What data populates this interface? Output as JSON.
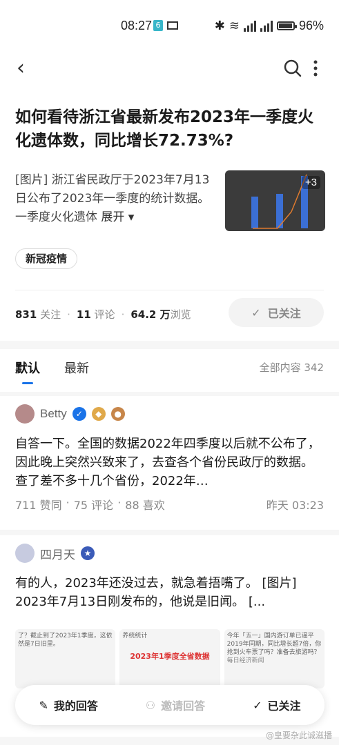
{
  "status": {
    "time": "08:27",
    "notif_badge": "6",
    "battery": "96%"
  },
  "question": {
    "title": "如何看待浙江省最新发布2023年一季度火化遗体数，同比增长72.73%?",
    "excerpt": "[图片] 浙江省民政厅于2023年7月13日公布了2023年一季度的统计数据。一季度火化遗体",
    "expand": "展开",
    "thumb_more": "+3",
    "tag": "新冠疫情",
    "followers_count": "831",
    "followers_label": "关注",
    "comments_count": "11",
    "comments_label": "评论",
    "views_count": "64.2 万",
    "views_label": "浏览",
    "follow_btn": "已关注"
  },
  "tabs": {
    "default": "默认",
    "latest": "最新",
    "all_count": "全部内容 342"
  },
  "answers": [
    {
      "author": "Betty",
      "text": "自答一下。全国的数据2022年四季度以后就不公布了，因此晚上突然兴致来了，去查各个省份民政厅的数据。 查了差不多十几个省份，2022年…",
      "likes": "711 赞同",
      "comments": "75 评论",
      "favs": "88 喜欢",
      "time": "昨天 03:23"
    },
    {
      "author": "四月天",
      "text": "有的人，2023年还没过去，就急着捂嘴了。 [图片] 2023年7月13日刚发布的，他说是旧闻。 [...",
      "img1_text": "了？截止到了2023年1季度，这依然是7日旧里。",
      "img2_head": "养统统计",
      "img2_title": "2023年1季度全省数据",
      "img3_text": "今年「五一」国内游订单已逼平2019年同期，同比增长超7倍，你抢到火车票了吗？准备去旅游吗？",
      "img3_src": "每日经济新闻"
    }
  ],
  "bottom": {
    "my_answer": "我的回答",
    "invite": "邀请回答",
    "followed": "已关注"
  },
  "watermark": "@皇要杂此诚滋播"
}
